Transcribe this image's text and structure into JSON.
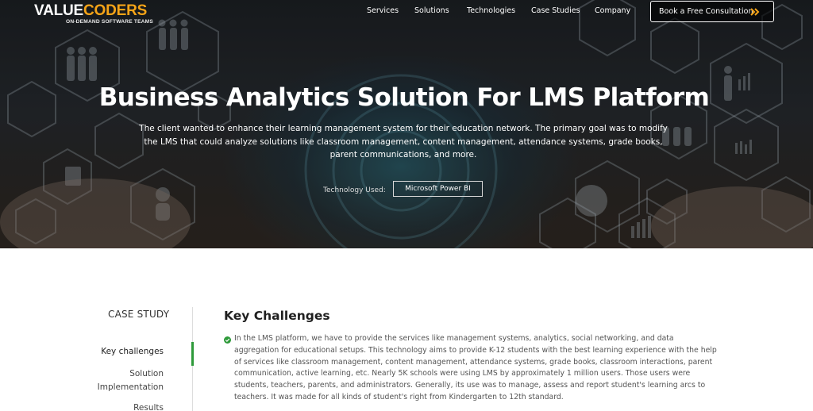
{
  "header": {
    "logo_white": "VALUE",
    "logo_orange": "CODERS",
    "logo_tagline": "ON-DEMAND SOFTWARE TEAMS",
    "nav": [
      "Services",
      "Solutions",
      "Technologies",
      "Case Studies",
      "Company"
    ],
    "cta_label": "Book a Free Consultation"
  },
  "hero": {
    "title": "Business Analytics Solution For LMS Platform",
    "description": "The client wanted to enhance their learning management system for their education network. The primary goal was to modify the LMS that could analyze solutions like classroom management, content management, attendance systems, grade books, parent communications, and more.",
    "tech_label": "Technology Used:",
    "tech_value": "Microsoft Power BI"
  },
  "sidebar": {
    "heading": "CASE STUDY",
    "items": [
      "Key challenges",
      "Solution Implementation",
      "Results"
    ],
    "active_index": 0
  },
  "content": {
    "title": "Key Challenges",
    "paragraph": "In the LMS platform, we have to provide the services like management systems, analytics, social networking, and data aggregation for educational setups. This technology aims to provide K-12 students with the best learning experience with the help of services like classroom management, content management, attendance systems, grade books, classroom interactions, parent communication, active learning, etc. Nearly 5K schools were using LMS by approximately 1 million users. Those users were students, teachers, parents, and administrators. Generally, its use was to manage, assess and report student's learning arcs to teachers. It was made for all kinds of student's right from Kindergarten to 12th standard."
  },
  "colors": {
    "brand_orange": "#f6a417",
    "accent_green": "#2e9a3a",
    "hero_dark": "#1c1f23"
  },
  "icons": [
    "arrow-right-icon",
    "check-circle-icon"
  ]
}
